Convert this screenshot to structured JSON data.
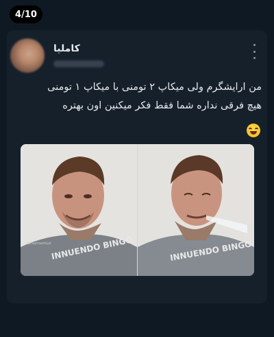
{
  "counter": "4/10",
  "tweet": {
    "author_name": "کاملیا",
    "text_line1": "من ارایشگرم ولی میکاپ ۲ تومنی با میکاپ ۱ تومنی",
    "text_line2": "هیچ فرقی نداره شما فقط فکر میکنین اون بهتره",
    "emoji": "grinning-sweat-face",
    "image_watermark": "FB/SarcasmLol",
    "shirt_text": "INNUENDO BINGO"
  },
  "colors": {
    "background": "#0f1923",
    "card": "#15202b",
    "text": "#e7e9ea",
    "muted": "#8b98a5"
  }
}
